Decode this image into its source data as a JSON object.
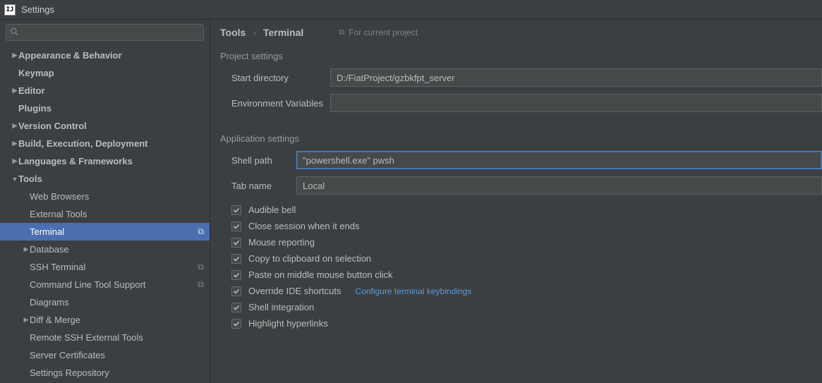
{
  "window": {
    "title": "Settings"
  },
  "search": {
    "placeholder": ""
  },
  "tree": {
    "appearance": "Appearance & Behavior",
    "keymap": "Keymap",
    "editor": "Editor",
    "plugins": "Plugins",
    "vcs": "Version Control",
    "build": "Build, Execution, Deployment",
    "lang": "Languages & Frameworks",
    "tools": "Tools",
    "web": "Web Browsers",
    "external": "External Tools",
    "terminal": "Terminal",
    "database": "Database",
    "ssh": "SSH Terminal",
    "cmdline": "Command Line Tool Support",
    "diagrams": "Diagrams",
    "diff": "Diff & Merge",
    "remotessh": "Remote SSH External Tools",
    "servercert": "Server Certificates",
    "settingsrepo": "Settings Repository"
  },
  "breadcrumb": {
    "a": "Tools",
    "b": "Terminal"
  },
  "scope": "For current project",
  "section1": "Project settings",
  "startdir": {
    "label": "Start directory",
    "value": "D:/FiatProject/gzbkfpt_server"
  },
  "envvar": {
    "label": "Environment Variables",
    "value": ""
  },
  "section2": "Application settings",
  "shellpath": {
    "label": "Shell path",
    "value": "\"powershell.exe\" pwsh"
  },
  "tabname": {
    "label": "Tab name",
    "value": "Local"
  },
  "checks": {
    "audible": "Audible bell",
    "close": "Close session when it ends",
    "mouse": "Mouse reporting",
    "copy": "Copy to clipboard on selection",
    "paste": "Paste on middle mouse button click",
    "override": "Override IDE shortcuts",
    "configlink": "Configure terminal keybindings",
    "shellint": "Shell integration",
    "highlight": "Highlight hyperlinks"
  }
}
